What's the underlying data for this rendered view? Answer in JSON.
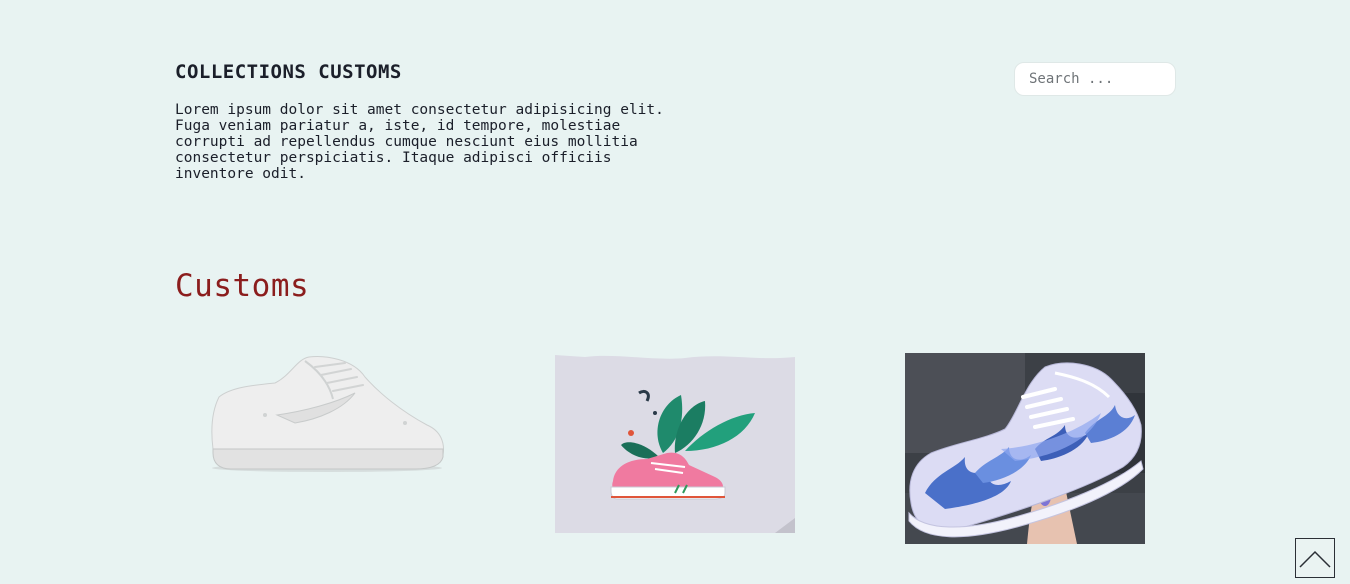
{
  "header": {
    "title": "COLLECTIONS CUSTOMS",
    "description": "Lorem ipsum dolor sit amet consectetur adipisicing elit. Fuga veniam pariatur a, iste, id tempore, molestiae corrupti ad repellendus cumque nesciunt eius mollitia consectetur perspiciatis. Itaque adipisci officiis inventore odit."
  },
  "search": {
    "placeholder": "Search ..."
  },
  "section": {
    "title": "Customs"
  },
  "products": [
    {
      "image": "white-sneaker-image"
    },
    {
      "image": "plant-sneaker-illustration"
    },
    {
      "image": "blue-flame-custom-sneaker-photo"
    }
  ],
  "controls": {
    "back_to_top_icon": "chevron-up-icon"
  },
  "colors": {
    "background": "#e8f3f2",
    "text": "#1b1f2a",
    "accent": "#8b1d1d"
  }
}
